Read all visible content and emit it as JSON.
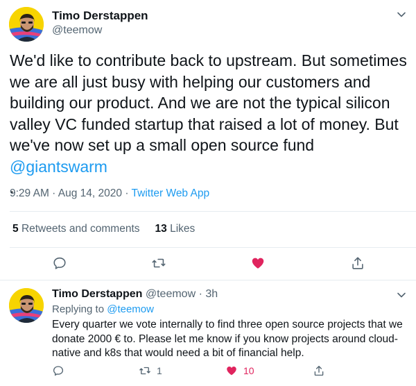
{
  "main_tweet": {
    "author_name": "Timo Derstappen",
    "author_handle": "@teemow",
    "text_before_link": "We'd like to contribute back to upstream. But sometimes we are all just busy with helping our customers and building our product. And we are not the typical silicon valley VC funded startup that raised a lot of money. But we've now set up a small open source fund ",
    "mention": "@giantswarm",
    "text_after_link": ".",
    "timestamp": "9:29 AM · Aug 14, 2020 · ",
    "source": "Twitter Web App",
    "retweets_count": "5",
    "retweets_label": "Retweets and comments",
    "likes_count": "13",
    "likes_label": "Likes",
    "liked": true,
    "like_color": "#e0245e"
  },
  "reply_tweet": {
    "author_name": "Timo Derstappen",
    "author_handle": "@teemow",
    "separator": " · ",
    "time_ago": "3h",
    "replying_prefix": "Replying to ",
    "replying_to": "@teemow",
    "text": "Every quarter we vote internally to find three open source projects that we donate 2000 € to. Please let me know if you know projects around cloud-native and k8s that would need a bit of financial help.",
    "retweet_count": "1",
    "like_count": "10"
  },
  "icons": {
    "reply": "comment-icon",
    "retweet": "retweet-icon",
    "like": "heart-icon",
    "share": "share-icon",
    "more": "chevron-down-icon"
  },
  "colors": {
    "accent": "#1d9bf0",
    "secondary_text": "#536471",
    "like": "#e0245e"
  }
}
